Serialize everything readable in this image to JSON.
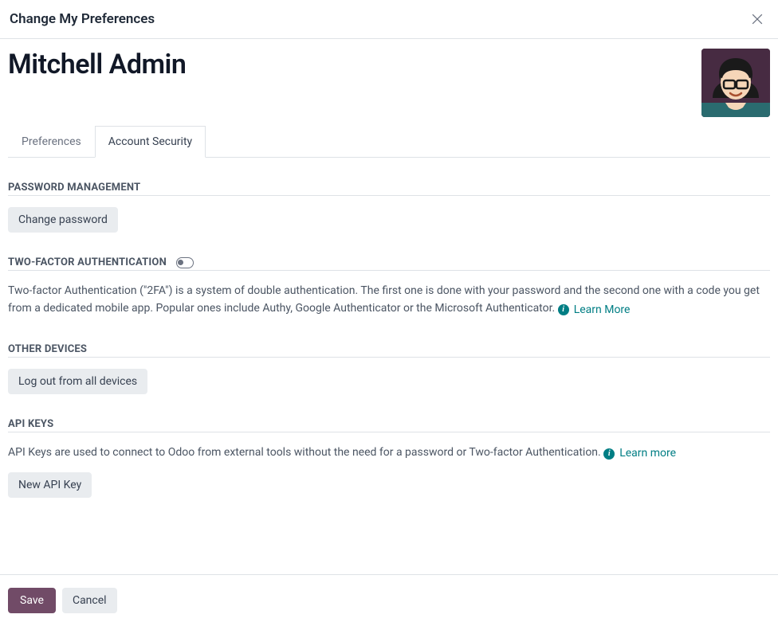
{
  "modal": {
    "title": "Change My Preferences"
  },
  "identity": {
    "name": "Mitchell Admin"
  },
  "tabs": {
    "preferences": "Preferences",
    "account_security": "Account Security"
  },
  "sections": {
    "password": {
      "title": "PASSWORD MANAGEMENT",
      "button": "Change password"
    },
    "tfa": {
      "title": "TWO-FACTOR AUTHENTICATION",
      "enabled": false,
      "desc": "Two-factor Authentication (\"2FA\") is a system of double authentication. The first one is done with your password and the second one with a code you get from a dedicated mobile app. Popular ones include Authy, Google Authenticator or the Microsoft Authenticator. ",
      "learn_more": "Learn More"
    },
    "devices": {
      "title": "OTHER DEVICES",
      "button": "Log out from all devices"
    },
    "api": {
      "title": "API KEYS",
      "desc": "API Keys are used to connect to Odoo from external tools without the need for a password or Two-factor Authentication. ",
      "learn_more": "Learn more",
      "button": "New API Key"
    }
  },
  "footer": {
    "save": "Save",
    "cancel": "Cancel"
  },
  "colors": {
    "primary": "#714b67",
    "link": "#017e84"
  }
}
